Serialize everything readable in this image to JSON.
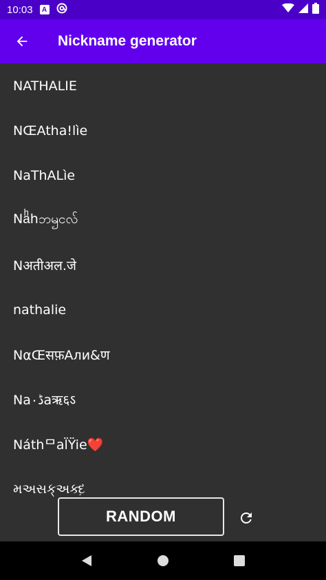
{
  "status_bar": {
    "time": "10:03",
    "icons": [
      "text-a-icon",
      "at-sign-icon",
      "wifi-icon",
      "signal-icon",
      "battery-icon"
    ],
    "a_glyph": "A"
  },
  "app_bar": {
    "title": "Nickname generator",
    "back_icon": "arrow-back-icon"
  },
  "nicknames": [
    "NATHALIE",
    "NŒAtha!lìe",
    "NaThALìe",
    "Naͪhဘၝငလ်",
    "Nअतीअल.जे",
    "nathalie",
    "NαŒसफ़Али&ण",
    "Na۰ڈaऋ६ऽ",
    "Náthᄆal̈Ÿie❤️",
    "મઅસક્અક્દ઼"
  ],
  "random_button": {
    "label": "RANDOM"
  },
  "refresh_icon": "refresh-icon",
  "nav_bar": {
    "icons": [
      "back-triangle-icon",
      "home-circle-icon",
      "recents-square-icon"
    ]
  },
  "colors": {
    "status_bar": "#4b00c8",
    "app_bar": "#6200ee",
    "background": "#303030",
    "nav_bar": "#000000",
    "text": "#ffffff"
  }
}
